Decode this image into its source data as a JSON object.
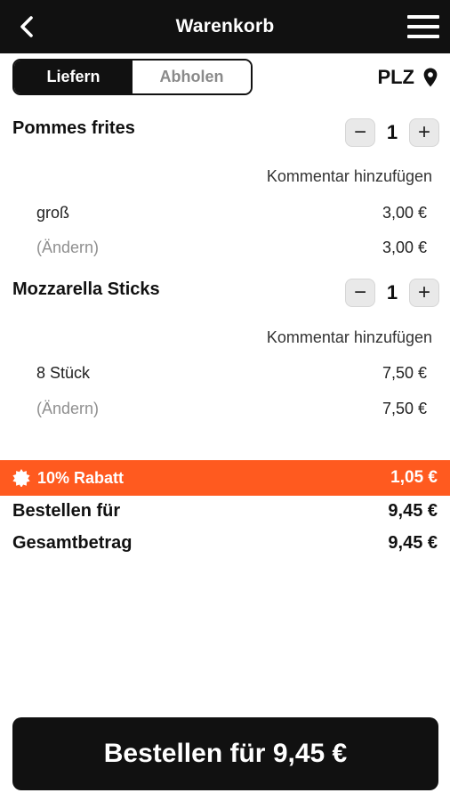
{
  "header": {
    "title": "Warenkorb",
    "back_icon": "chevron-left-icon",
    "menu_icon": "hamburger-menu-icon"
  },
  "delivery_toggle": {
    "options": [
      "Liefern",
      "Abholen"
    ],
    "selected": "Liefern"
  },
  "location": {
    "label": "PLZ",
    "icon": "map-pin-icon"
  },
  "cart_items": [
    {
      "name": "Pommes frites",
      "quantity": "1",
      "comment_link": "Kommentar hinzufügen",
      "option_label": "groß",
      "option_price": "3,00 €",
      "change_label": "(Ändern)",
      "total_price": "3,00 €"
    },
    {
      "name": "Mozzarella Sticks",
      "quantity": "1",
      "comment_link": "Kommentar hinzufügen",
      "option_label": "8 Stück",
      "option_price": "7,50 €",
      "change_label": "(Ändern)",
      "total_price": "7,50 €"
    }
  ],
  "discount": {
    "label": "10% Rabatt",
    "value": "1,05 €",
    "icon": "badge-burst-icon",
    "color": "#ff5a1f"
  },
  "summary": {
    "order_label": "Bestellen für",
    "order_value": "9,45 €",
    "total_label": "Gesamtbetrag",
    "total_value": "9,45 €"
  },
  "cta": {
    "label": "Bestellen für 9,45 €"
  },
  "colors": {
    "primary": "#111111",
    "accent": "#ff5a1f",
    "background": "#ffffff"
  }
}
